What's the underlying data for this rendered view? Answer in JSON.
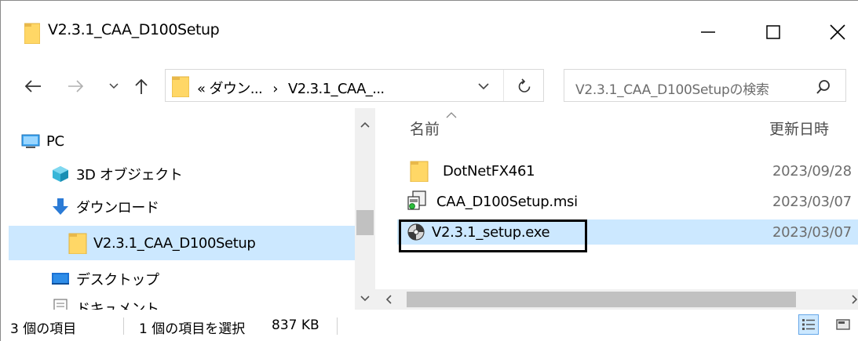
{
  "window": {
    "title": "V2.3.1_CAA_D100Setup",
    "minimize_label": "—",
    "maximize_label": "☐",
    "close_label": "✕"
  },
  "address": {
    "prefix": "«",
    "path_part1": "ダウン...",
    "separator": "›",
    "path_part2": "V2.3.1_CAA_..."
  },
  "search": {
    "placeholder": "V2.3.1_CAA_D100Setupの検索"
  },
  "nav_tree": [
    {
      "label": "PC",
      "icon": "pc-icon"
    },
    {
      "label": "3D オブジェクト",
      "icon": "3d-objects-icon"
    },
    {
      "label": "ダウンロード",
      "icon": "download-icon"
    },
    {
      "label": "V2.3.1_CAA_D100Setup",
      "icon": "folder-icon",
      "selected": true
    },
    {
      "label": "デスクトップ",
      "icon": "desktop-icon"
    },
    {
      "label": "ドキュメント",
      "icon": "documents-icon"
    }
  ],
  "columns": {
    "name": "名前",
    "modified": "更新日時"
  },
  "files": [
    {
      "name": "DotNetFX461",
      "date": "2023/09/28",
      "icon": "folder-icon"
    },
    {
      "name": "CAA_D100Setup.msi",
      "date": "2023/03/07",
      "icon": "msi-installer-icon"
    },
    {
      "name": "V2.3.1_setup.exe",
      "date": "2023/03/07",
      "icon": "setup-exe-icon",
      "selected": true
    }
  ],
  "status": {
    "item_count": "3 個の項目",
    "selection": "1 個の項目を選択",
    "size": "837 KB"
  },
  "colors": {
    "selection": "#cce8ff",
    "folder": "#ffd766",
    "accent": "#0078d7"
  }
}
